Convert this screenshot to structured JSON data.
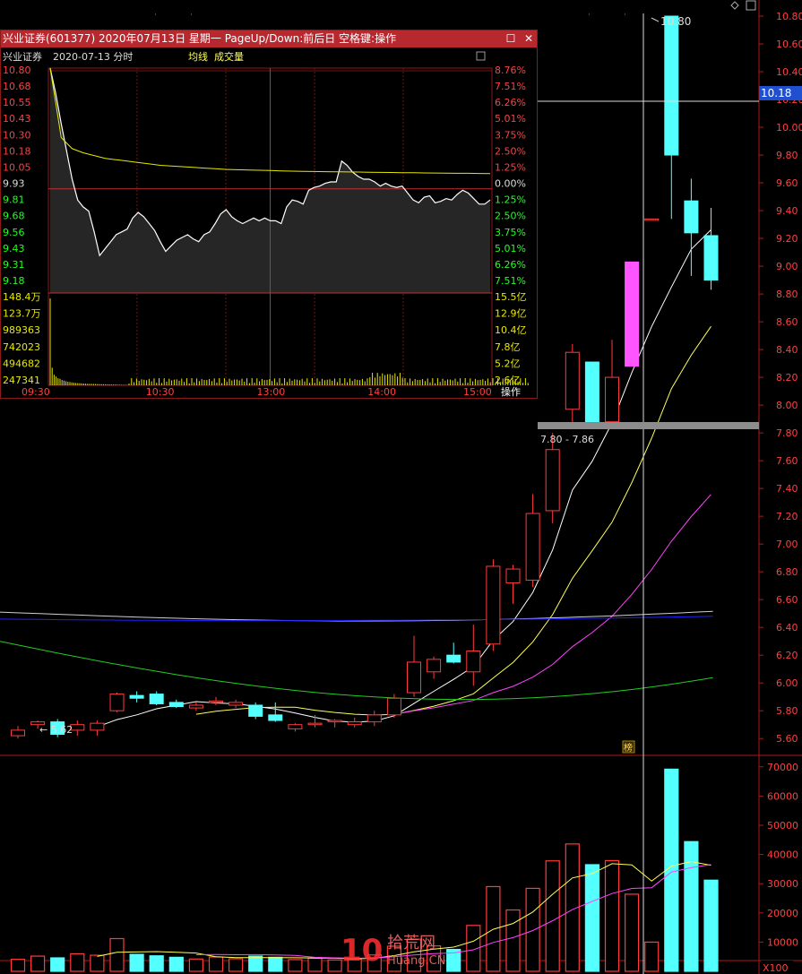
{
  "colors": {
    "up": "#ff3b3b",
    "down": "#54ffff",
    "limit_up": "#ff55ff",
    "ma5": "#ffffff",
    "ma10": "#ffff55",
    "ma20": "#ff44ff",
    "ma60": "#22cc22",
    "ma_long1": "#cfcfcf",
    "ma_long2": "#2020ff",
    "grid": "#7a1010",
    "axis_red": "#ff4040",
    "axis_green": "#22ff22",
    "axis_yellow": "#e8e800",
    "popup_title_bg": "#b8282f"
  },
  "main_chart": {
    "price_ticks": [
      "10.80",
      "10.60",
      "10.40",
      "10.20",
      "10.00",
      "9.80",
      "9.60",
      "9.40",
      "9.20",
      "9.00",
      "8.80",
      "8.60",
      "8.40",
      "8.20",
      "8.00",
      "7.80",
      "7.60",
      "7.40",
      "7.20",
      "7.00",
      "6.80",
      "6.60",
      "6.40",
      "6.20",
      "6.00",
      "5.80",
      "5.60"
    ],
    "price_range": [
      5.535,
      10.915
    ],
    "current_price_label": "10.18",
    "high_marker": "10.80",
    "low_marker": "5.62",
    "range_label": "7.80 - 7.86",
    "tag_label": "榜",
    "candles": [
      {
        "o": 5.62,
        "h": 5.69,
        "l": 5.6,
        "c": 5.66
      },
      {
        "o": 5.7,
        "h": 5.73,
        "l": 5.67,
        "c": 5.72
      },
      {
        "o": 5.72,
        "h": 5.74,
        "l": 5.61,
        "c": 5.63
      },
      {
        "o": 5.66,
        "h": 5.73,
        "l": 5.62,
        "c": 5.7
      },
      {
        "o": 5.66,
        "h": 5.73,
        "l": 5.62,
        "c": 5.71
      },
      {
        "o": 5.8,
        "h": 5.93,
        "l": 5.79,
        "c": 5.92
      },
      {
        "o": 5.91,
        "h": 5.94,
        "l": 5.86,
        "c": 5.89
      },
      {
        "o": 5.92,
        "h": 5.94,
        "l": 5.84,
        "c": 5.85
      },
      {
        "o": 5.86,
        "h": 5.88,
        "l": 5.82,
        "c": 5.83
      },
      {
        "o": 5.82,
        "h": 5.86,
        "l": 5.8,
        "c": 5.84
      },
      {
        "o": 5.86,
        "h": 5.9,
        "l": 5.84,
        "c": 5.87
      },
      {
        "o": 5.84,
        "h": 5.88,
        "l": 5.82,
        "c": 5.86
      },
      {
        "o": 5.84,
        "h": 5.86,
        "l": 5.74,
        "c": 5.76
      },
      {
        "o": 5.77,
        "h": 5.86,
        "l": 5.72,
        "c": 5.73
      },
      {
        "o": 5.67,
        "h": 5.71,
        "l": 5.65,
        "c": 5.7
      },
      {
        "o": 5.7,
        "h": 5.77,
        "l": 5.68,
        "c": 5.71
      },
      {
        "o": 5.72,
        "h": 5.74,
        "l": 5.68,
        "c": 5.73
      },
      {
        "o": 5.7,
        "h": 5.75,
        "l": 5.68,
        "c": 5.72
      },
      {
        "o": 5.72,
        "h": 5.8,
        "l": 5.69,
        "c": 5.77
      },
      {
        "o": 5.77,
        "h": 5.92,
        "l": 5.75,
        "c": 5.89
      },
      {
        "o": 5.93,
        "h": 6.34,
        "l": 5.9,
        "c": 6.15
      },
      {
        "o": 6.08,
        "h": 6.19,
        "l": 6.03,
        "c": 6.17
      },
      {
        "o": 6.2,
        "h": 6.29,
        "l": 6.14,
        "c": 6.15
      },
      {
        "o": 6.08,
        "h": 6.42,
        "l": 5.98,
        "c": 6.23
      },
      {
        "o": 6.28,
        "h": 6.89,
        "l": 6.23,
        "c": 6.84
      },
      {
        "o": 6.72,
        "h": 6.85,
        "l": 6.57,
        "c": 6.82
      },
      {
        "o": 6.74,
        "h": 7.36,
        "l": 6.69,
        "c": 7.22
      },
      {
        "o": 7.24,
        "h": 7.8,
        "l": 7.15,
        "c": 7.68
      },
      {
        "o": 7.97,
        "h": 8.44,
        "l": 7.85,
        "c": 8.38
      },
      {
        "o": 8.31,
        "h": 8.31,
        "l": 7.86,
        "c": 7.88
      },
      {
        "o": 7.88,
        "h": 8.47,
        "l": 7.87,
        "c": 8.2
      },
      {
        "o": 8.28,
        "h": 9.03,
        "l": 8.28,
        "c": 9.03
      },
      {
        "o": 9.34,
        "h": 9.34,
        "l": 9.34,
        "c": 9.34
      },
      {
        "o": 10.8,
        "h": 10.8,
        "l": 9.34,
        "c": 9.8
      },
      {
        "o": 9.47,
        "h": 9.63,
        "l": 8.93,
        "c": 9.24
      },
      {
        "o": 9.22,
        "h": 9.42,
        "l": 8.83,
        "c": 8.9
      }
    ],
    "volumes": [
      4100,
      5200,
      4600,
      6000,
      5500,
      11200,
      5800,
      5300,
      4800,
      4200,
      4900,
      4300,
      5200,
      4800,
      4000,
      4500,
      3900,
      4200,
      5600,
      8600,
      11000,
      8700,
      7500,
      15700,
      29000,
      21000,
      28400,
      37800,
      43600,
      36500,
      37900,
      26400,
      10000,
      69200,
      44400,
      31200
    ],
    "volume_ticks": [
      "70000",
      "60000",
      "50000",
      "40000",
      "30000",
      "20000",
      "10000"
    ],
    "volume_max": 73000,
    "volume_unit": "X100"
  },
  "popup": {
    "title": "兴业证券(601377) 2020年07月13日 星期一 PageUp/Down:前后日 空格键:操作",
    "subtitle": {
      "name": "兴业证券",
      "date": "2020-07-13 分时",
      "avg_label": "均线",
      "vol_label": "成交量"
    },
    "price_labels": [
      "10.80",
      "10.68",
      "10.55",
      "10.43",
      "10.30",
      "10.18",
      "10.05",
      "9.93",
      "9.81",
      "9.68",
      "9.56",
      "9.43",
      "9.31",
      "9.18"
    ],
    "pct_labels": [
      "8.76%",
      "7.51%",
      "6.26%",
      "5.01%",
      "3.75%",
      "2.50%",
      "1.25%",
      "0.00%",
      "1.25%",
      "2.50%",
      "3.75%",
      "5.01%",
      "6.26%",
      "7.51%"
    ],
    "vol_labels": [
      "148.4万",
      "123.7万",
      "989363",
      "742023",
      "494682",
      "247341"
    ],
    "amount_labels": [
      "15.5亿",
      "12.9亿",
      "10.4亿",
      "7.8亿",
      "5.2亿",
      "2.6亿"
    ],
    "time_labels": [
      "09:30",
      "10:30",
      "13:00",
      "14:00",
      "15:00"
    ],
    "op_label": "操作",
    "prev_close": 9.93,
    "intraday": [
      10.8,
      10.62,
      10.4,
      10.2,
      10.0,
      9.85,
      9.8,
      9.77,
      9.62,
      9.45,
      9.5,
      9.55,
      9.6,
      9.62,
      9.64,
      9.72,
      9.76,
      9.73,
      9.68,
      9.63,
      9.55,
      9.48,
      9.52,
      9.56,
      9.58,
      9.6,
      9.57,
      9.55,
      9.6,
      9.62,
      9.68,
      9.75,
      9.78,
      9.73,
      9.7,
      9.68,
      9.7,
      9.72,
      9.7,
      9.72,
      9.7,
      9.7,
      9.68,
      9.8,
      9.85,
      9.84,
      9.82,
      9.92,
      9.94,
      9.95,
      9.97,
      9.98,
      9.98,
      10.13,
      10.1,
      10.05,
      10.02,
      10.0,
      10.0,
      9.98,
      9.95,
      9.97,
      9.95,
      9.94,
      9.95,
      9.9,
      9.85,
      9.83,
      9.87,
      9.88,
      9.83,
      9.84,
      9.86,
      9.85,
      9.89,
      9.92,
      9.9,
      9.86,
      9.82,
      9.82,
      9.85
    ],
    "avg_line": [
      10.8,
      10.3,
      10.22,
      10.19,
      10.17,
      10.15,
      10.14,
      10.13,
      10.12,
      10.11,
      10.1,
      10.095,
      10.09,
      10.085,
      10.08,
      10.075,
      10.07,
      10.068,
      10.066,
      10.064,
      10.062,
      10.06,
      10.058,
      10.056,
      10.055,
      10.054,
      10.053,
      10.052,
      10.051,
      10.05,
      10.049,
      10.048,
      10.047,
      10.046,
      10.045,
      10.044,
      10.043,
      10.042,
      10.042,
      10.041,
      10.04
    ],
    "vol_bars": [
      1484000,
      300000,
      180000,
      150000,
      120000,
      110000,
      90000,
      80000,
      70000,
      60000,
      55000,
      50000,
      45000,
      40000,
      38000,
      36000,
      34000,
      30000,
      28000,
      26000,
      25000,
      24000,
      23000,
      22000,
      21000,
      20000,
      19000,
      18000,
      17000,
      16000,
      15000,
      14000,
      13000,
      12000,
      11000,
      10000,
      9000,
      8000,
      7000,
      6000
    ]
  }
}
